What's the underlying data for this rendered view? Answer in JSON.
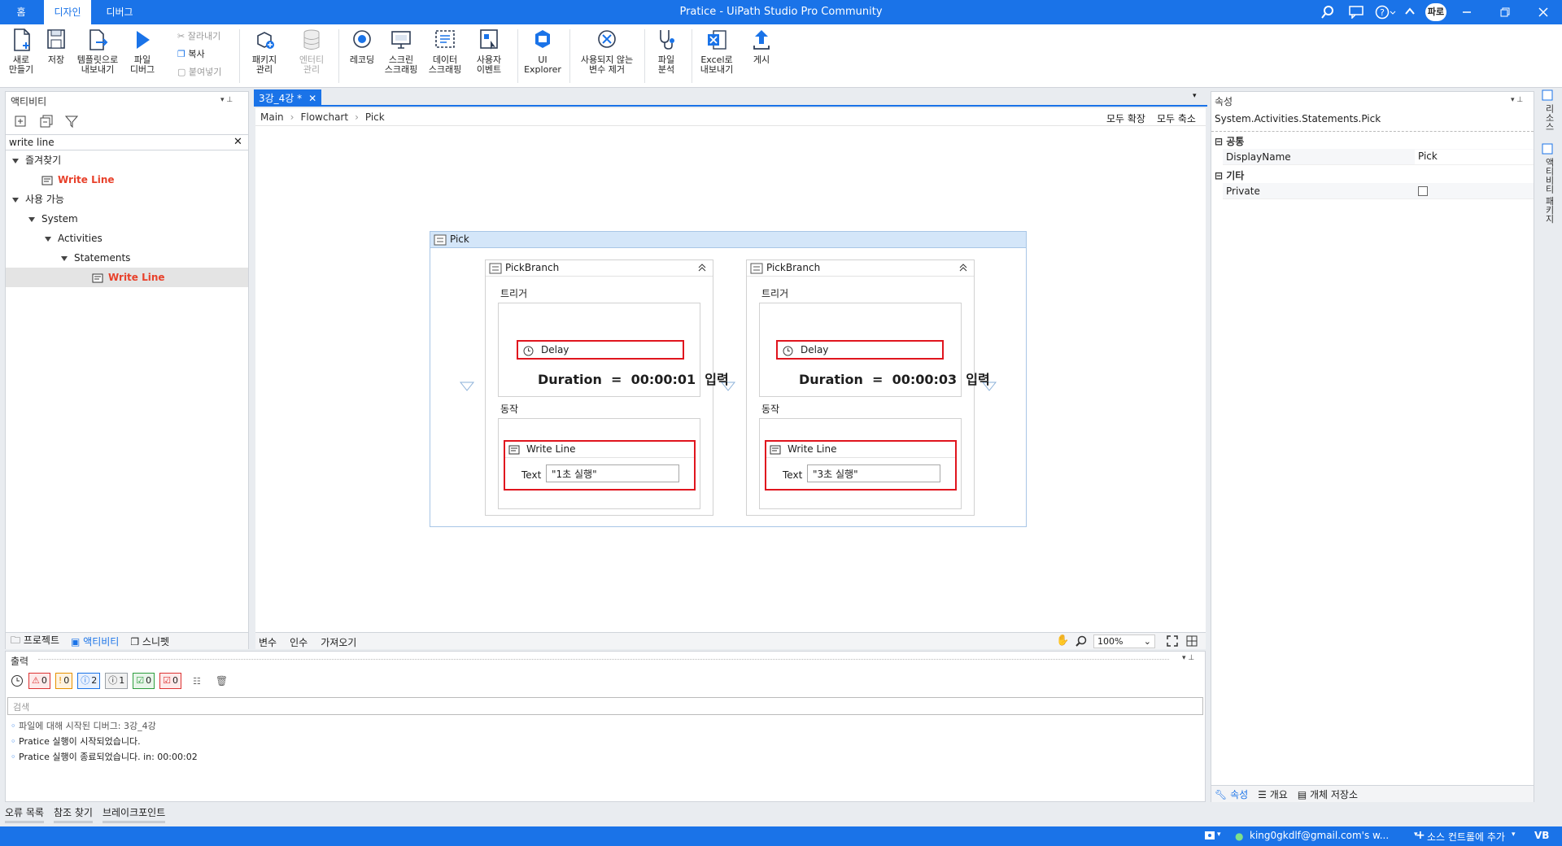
{
  "window": {
    "title": "Pratice - UiPath Studio Pro Community",
    "user_badge": "파로"
  },
  "title_tabs": [
    {
      "label": "홈"
    },
    {
      "label": "디자인"
    },
    {
      "label": "디버그"
    }
  ],
  "ribbon": {
    "new": "새로\n만들기",
    "save": "저장",
    "export_template": "템플릿으로\n내보내기",
    "debug_file": "파일\n디버그",
    "cut": "잘라내기",
    "copy": "복사",
    "paste": "붙여넣기",
    "manage_packages": "패키지\n관리",
    "manage_entities": "엔터티\n관리",
    "recording": "레코딩",
    "screen_scraping": "스크린\n스크래핑",
    "data_scraping": "데이터\n스크래핑",
    "user_events": "사용자\n이벤트",
    "ui_explorer": "UI\nExplorer",
    "remove_unused_vars": "사용되지 않는\n변수 제거",
    "analyze_file": "파일\n분석",
    "export_excel": "Excel로\n내보내기",
    "publish": "게시"
  },
  "activities_panel": {
    "title": "액티비티",
    "search_value": "write line",
    "tree": {
      "favorites": "즐겨찾기",
      "fav_item": "Write Line",
      "available": "사용 가능",
      "system": "System",
      "activities": "Activities",
      "statements": "Statements",
      "leaf": "Write Line"
    },
    "bottom_tabs": [
      "프로젝트",
      "액티비티",
      "스니펫"
    ]
  },
  "designer": {
    "doc_tab": "3강_4강 *",
    "breadcrumb": [
      "Main",
      "Flowchart",
      "Pick"
    ],
    "expand_all": "모두 확장",
    "collapse_all": "모두 축소",
    "pick_title": "Pick",
    "branches": [
      {
        "title": "PickBranch",
        "trigger_label": "트리거",
        "delay_label": "Delay",
        "annotation": "Duration  =  00:00:01  입력",
        "action_label": "동작",
        "write_title": "Write Line",
        "text_label": "Text",
        "text_value": "\"1초 실행\""
      },
      {
        "title": "PickBranch",
        "trigger_label": "트리거",
        "delay_label": "Delay",
        "annotation": "Duration  =  00:00:03  입력",
        "action_label": "동작",
        "write_title": "Write Line",
        "text_label": "Text",
        "text_value": "\"3초 실행\""
      }
    ],
    "bottom_tabs": [
      "변수",
      "인수",
      "가져오기"
    ],
    "zoom": "100%"
  },
  "properties": {
    "title": "속성",
    "type_name": "System.Activities.Statements.Pick",
    "cat_common": "공통",
    "displayname_label": "DisplayName",
    "displayname_value": "Pick",
    "cat_misc": "기타",
    "private_label": "Private",
    "bottom_tabs": [
      "속성",
      "개요",
      "개체 저장소"
    ]
  },
  "right_rail": [
    "리소스",
    "액티비티 패키지"
  ],
  "output": {
    "title": "출력",
    "counters": [
      "0",
      "0",
      "2",
      "1",
      "0",
      "0"
    ],
    "search_placeholder": "검색",
    "lines": [
      "파일에 대해 시작된 디버그: 3강_4강",
      "Pratice 실행이 시작되었습니다.",
      "Pratice 실행이 종료되었습니다. in: 00:00:02"
    ]
  },
  "bottom_tabs": [
    "오류 목록",
    "참조 찾기",
    "브레이크포인트"
  ],
  "status": {
    "account": "king0gkdlf@gmail.com's w...",
    "source_control": "소스 컨트롤에 추가",
    "vb": "VB"
  },
  "colors": {
    "brand": "#1a73e8",
    "highlight_red": "#e0151e",
    "tree_red": "#e8412b"
  }
}
